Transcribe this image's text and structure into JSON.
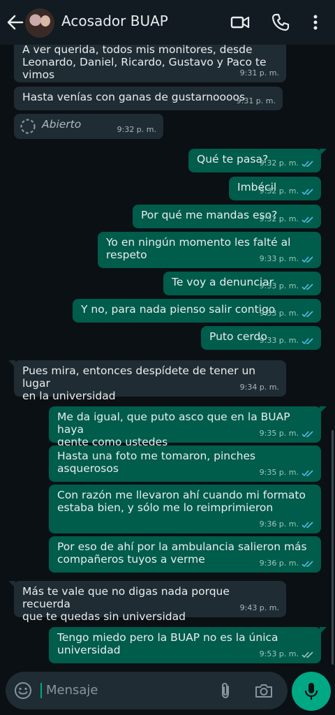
{
  "header": {
    "title": "Acosador BUAP"
  },
  "messages": [
    {
      "dir": "in",
      "text": "A ver querida, todos mis monitores, desde\nLeonardo, Daniel, Ricardo, Gustavo y Paco te\nvimos",
      "time": "9:31 p. m."
    },
    {
      "dir": "in",
      "text": "Hasta venías con ganas de gustarnoooos",
      "time": "9:31 p. m."
    },
    {
      "dir": "in",
      "text": "Abierto",
      "time": "9:32 p. m.",
      "viewonce": true
    },
    {
      "dir": "out",
      "text": "Qué te pasa?",
      "time": "9:32 p. m."
    },
    {
      "dir": "out",
      "text": "Imbécil",
      "time": "9:32 p. m."
    },
    {
      "dir": "out",
      "text": "Por qué me mandas eso?",
      "time": "9:32 p. m."
    },
    {
      "dir": "out",
      "text": "Yo en ningún momento les falté al respeto",
      "time": "9:33 p. m."
    },
    {
      "dir": "out",
      "text": "Te voy a denunciar",
      "time": "9:33 p. m."
    },
    {
      "dir": "out",
      "text": "Y no, para nada pienso salir contigo",
      "time": "9:33 p. m."
    },
    {
      "dir": "out",
      "text": "Puto cerdo",
      "time": "9:33 p. m."
    },
    {
      "dir": "in",
      "text": "Pues mira, entonces despídete de tener un lugar\nen la universidad",
      "time": "9:34 p. m."
    },
    {
      "dir": "out",
      "text": "Me da igual, que puto asco que en la BUAP haya\ngente como ustedes",
      "time": "9:35 p. m."
    },
    {
      "dir": "out",
      "text": "Hasta una foto me tomaron, pinches asquerosos",
      "time": "9:35 p. m."
    },
    {
      "dir": "out",
      "text": "Con razón me llevaron ahí cuando mi formato\nestaba bien, y sólo me lo reimprimieron",
      "time": "9:36 p. m."
    },
    {
      "dir": "out",
      "text": "Por eso de ahí por la ambulancia salieron más\ncompañeros tuyos a verme",
      "time": "9:36 p. m."
    },
    {
      "dir": "in",
      "text": "Más te vale que no digas nada porque recuerda\nque te quedas sin universidad",
      "time": "9:43 p. m."
    },
    {
      "dir": "out",
      "text": "Tengo miedo pero la BUAP no es la única\nuniversidad",
      "time": "9:53 p. m.",
      "read": false
    }
  ],
  "composer": {
    "placeholder": "Mensaje"
  }
}
